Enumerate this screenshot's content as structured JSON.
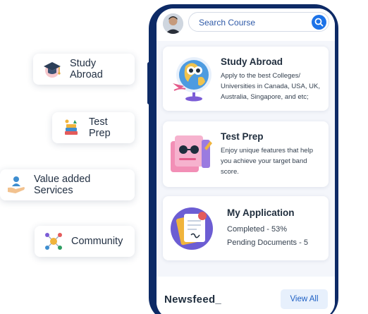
{
  "search": {
    "placeholder": "Search Course"
  },
  "pills": {
    "study_abroad": "Study Abroad",
    "test_prep": "Test Prep",
    "value_added": "Value added Services",
    "community": "Community"
  },
  "cards": {
    "study_abroad": {
      "title": "Study Abroad",
      "desc_1": "Apply to the best Colleges/",
      "desc_2": "Universities in Canada, USA, UK,",
      "desc_3": "Australia, Singapore, and etc;"
    },
    "test_prep": {
      "title": "Test Prep",
      "desc_1": "Enjoy unique features that help",
      "desc_2": "you achieve your target band",
      "desc_3": "score."
    },
    "my_application": {
      "title": "My Application",
      "completed": "Completed - 53%",
      "pending": "Pending Documents - 5"
    }
  },
  "newsfeed": {
    "title": "Newsfeed_",
    "view_all": "View All"
  },
  "colors": {
    "phone_frame": "#0d2a66",
    "accent_blue": "#1d73e8",
    "text_dark": "#1f2d3d"
  }
}
